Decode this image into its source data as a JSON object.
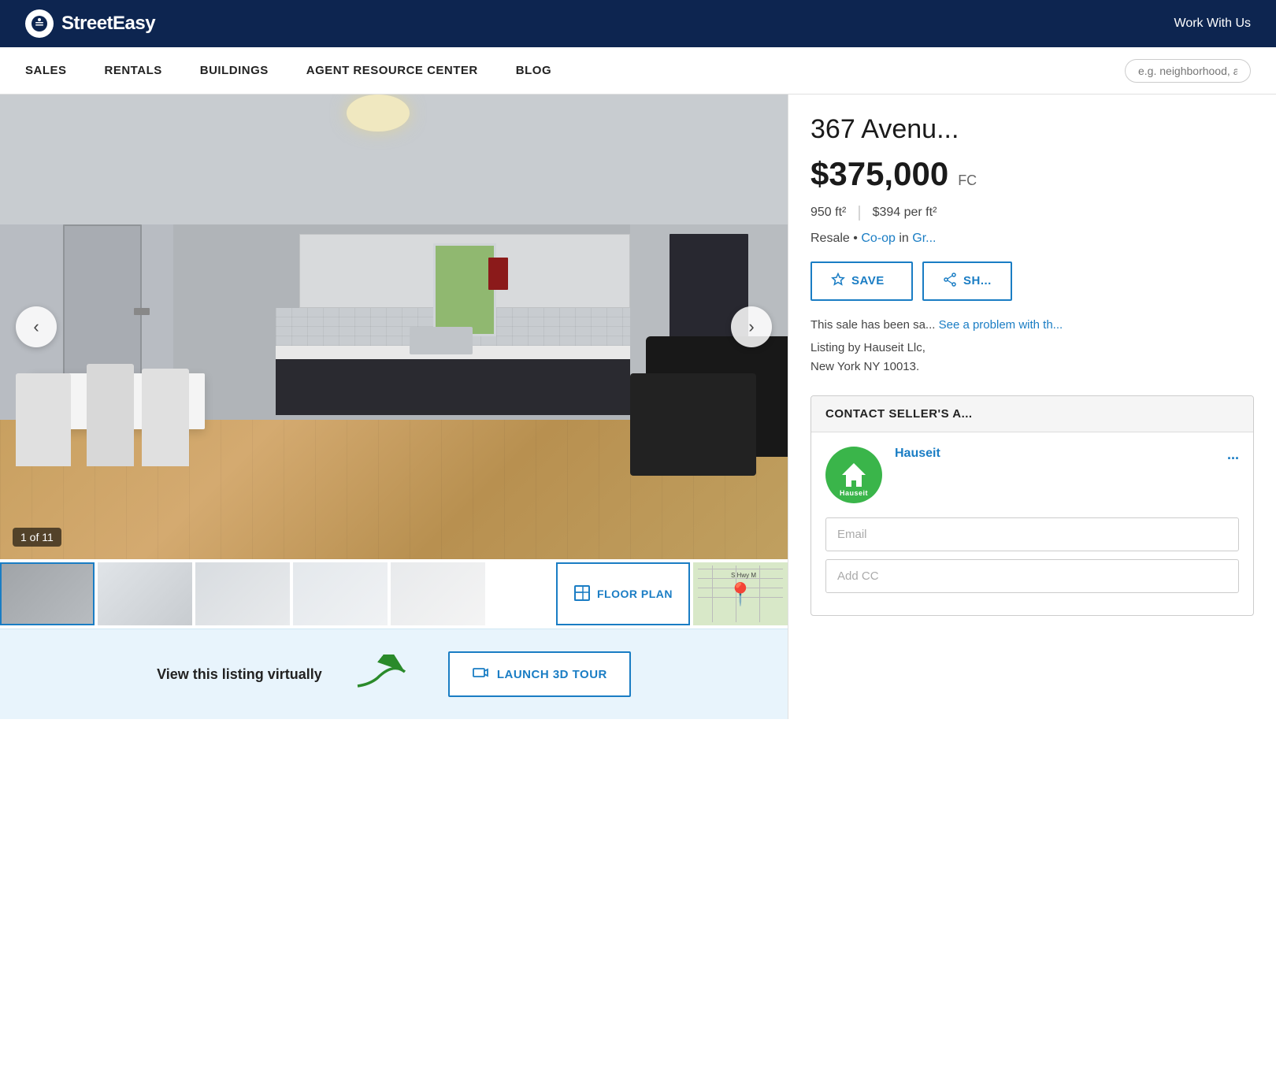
{
  "header": {
    "logo_text": "StreetEasy",
    "work_with_us": "Work With Us"
  },
  "nav": {
    "items": [
      {
        "label": "SALES"
      },
      {
        "label": "RENTALS"
      },
      {
        "label": "BUILDINGS"
      },
      {
        "label": "AGENT RESOURCE CENTER"
      },
      {
        "label": "BLOG"
      }
    ],
    "search_placeholder": "e.g. neighborhood, address"
  },
  "listing": {
    "address": "367 Avenu...",
    "address_full": "367 Avenue...",
    "price": "$375,000",
    "price_note": "FC",
    "sqft": "950 ft²",
    "price_per_sqft": "$394 per ft²",
    "type": "Resale",
    "listing_type": "Co-op",
    "neighborhood": "Gr...",
    "image_counter": "1 of 11",
    "save_label": "SAVE",
    "share_label": "SH...",
    "sale_notice": "This sale has been sa... See a problem with th...",
    "listing_by": "Listing by Hauseit Llc,\nNew York NY 10013.",
    "contact_seller_label": "CONTACT SELLER'S A...",
    "agent_company": "Hauseit",
    "email_placeholder": "Email",
    "add_cc_placeholder": "Add CC"
  },
  "virtual_tour": {
    "text": "View this listing virtually",
    "button_label": "LAUNCH 3D TOUR"
  },
  "floor_plan_btn": "FLOOR PLAN"
}
